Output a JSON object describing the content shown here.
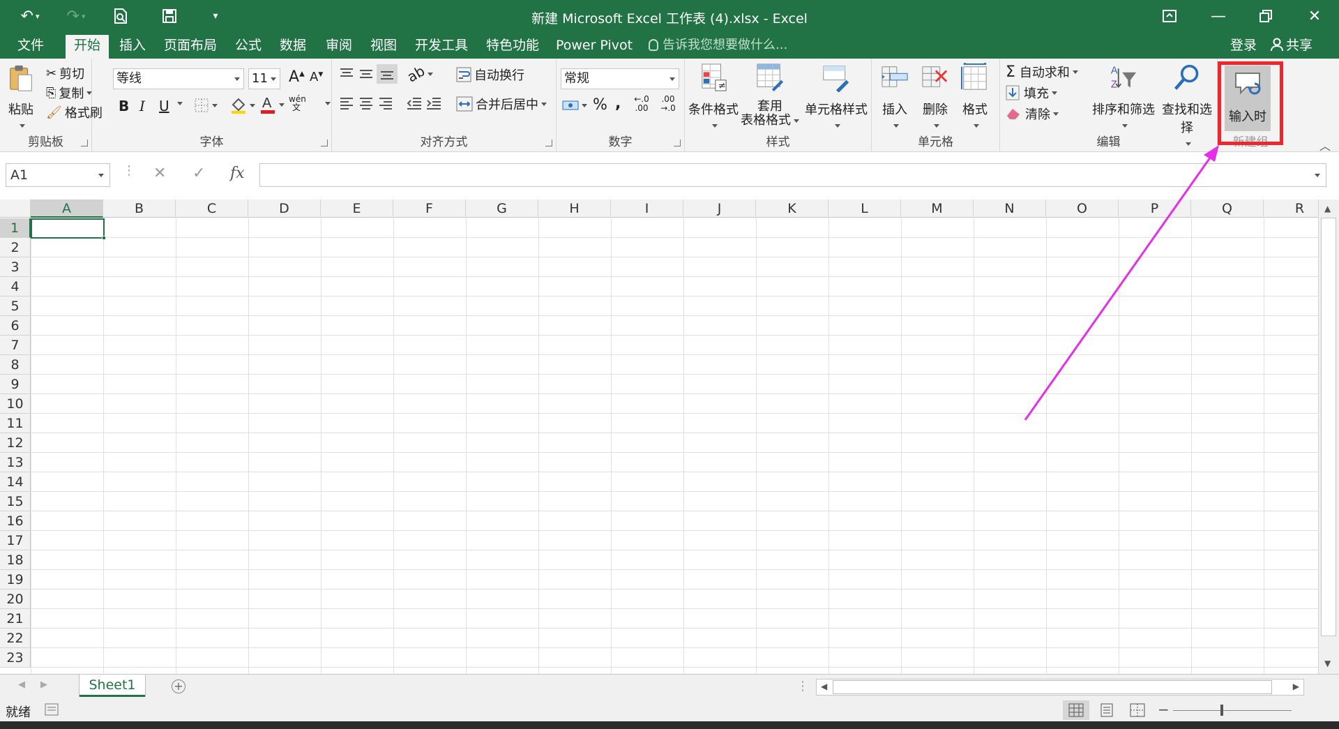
{
  "window": {
    "title": "新建 Microsoft Excel 工作表 (4).xlsx - Excel"
  },
  "tabs": [
    "文件",
    "开始",
    "插入",
    "页面布局",
    "公式",
    "数据",
    "审阅",
    "视图",
    "开发工具",
    "特色功能",
    "Power Pivot"
  ],
  "active_tab": "开始",
  "tell_me": "告诉我您想要做什么...",
  "account": {
    "login": "登录",
    "share": "共享"
  },
  "ribbon": {
    "clipboard": {
      "label": "剪贴板",
      "paste": "粘贴",
      "cut": "剪切",
      "copy": "复制",
      "format_painter": "格式刷"
    },
    "font": {
      "label": "字体",
      "font_name": "等线",
      "font_size": "11",
      "bold": "B",
      "italic": "I",
      "underline": "U",
      "phonetic": "wén 文"
    },
    "alignment": {
      "label": "对齐方式",
      "wrap_text": "自动换行",
      "merge_center": "合并后居中"
    },
    "number": {
      "label": "数字",
      "format": "常规",
      "percent": "%",
      "comma": ",",
      "inc_decimal": "←.0 .00",
      "dec_decimal": ".00 →.0"
    },
    "styles": {
      "label": "样式",
      "conditional": "条件格式",
      "table_format_1": "套用",
      "table_format_2": "表格格式",
      "cell_styles": "单元格样式"
    },
    "cells": {
      "label": "单元格",
      "insert": "插入",
      "delete": "删除",
      "format": "格式"
    },
    "editing": {
      "label": "编辑",
      "autosum": "自动求和",
      "fill": "填充",
      "clear": "清除",
      "sort_filter": "排序和筛选",
      "find_select": "查找和选择"
    },
    "new_group": {
      "label": "新建组",
      "input_time": "输入时"
    }
  },
  "formula_bar": {
    "name_box": "A1",
    "formula": "",
    "cancel": "✕",
    "enter": "✓",
    "fx": "fx"
  },
  "columns": [
    "A",
    "B",
    "C",
    "D",
    "E",
    "F",
    "G",
    "H",
    "I",
    "J",
    "K",
    "L",
    "M",
    "N",
    "O",
    "P",
    "Q",
    "R"
  ],
  "rows": [
    "1",
    "2",
    "3",
    "4",
    "5",
    "6",
    "7",
    "8",
    "9",
    "10",
    "11",
    "12",
    "13",
    "14",
    "15",
    "16",
    "17",
    "18",
    "19",
    "20",
    "21",
    "22",
    "23"
  ],
  "selected_cell": "A1",
  "sheets": [
    "Sheet1"
  ],
  "status": {
    "ready": "就绪"
  },
  "colors": {
    "excel_green": "#217346",
    "annotation": "#f0262d",
    "arrow": "#e62ee8"
  }
}
